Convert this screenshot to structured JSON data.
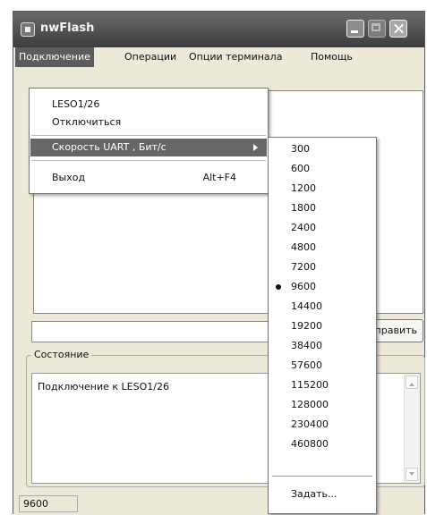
{
  "window": {
    "title": "nwFlash"
  },
  "menubar": {
    "items": [
      {
        "label": "Подключение"
      },
      {
        "label": "Операции"
      },
      {
        "label": "Опции терминала"
      },
      {
        "label": "Помощь"
      }
    ]
  },
  "connection_menu": {
    "items": [
      {
        "label": "LESO1/26"
      },
      {
        "label": "Отключиться"
      },
      {
        "label": "Скорость UART , Бит/с"
      },
      {
        "label": "Выход",
        "shortcut": "Alt+F4"
      }
    ]
  },
  "baud_submenu": {
    "selected": "9600",
    "items": [
      "300",
      "600",
      "1200",
      "1800",
      "2400",
      "4800",
      "7200",
      "9600",
      "14400",
      "19200",
      "38400",
      "57600",
      "115200",
      "128000",
      "230400",
      "460800"
    ],
    "custom_label": "Задать..."
  },
  "main": {
    "send_button_label": "Отправить"
  },
  "status_group": {
    "label": "Состояние",
    "text": "Подключение к LESO1/26"
  },
  "statusbar": {
    "value": "9600"
  },
  "colors": {
    "menu_highlight": "#5c5c5c",
    "titlebar": "#4a4a4a"
  }
}
